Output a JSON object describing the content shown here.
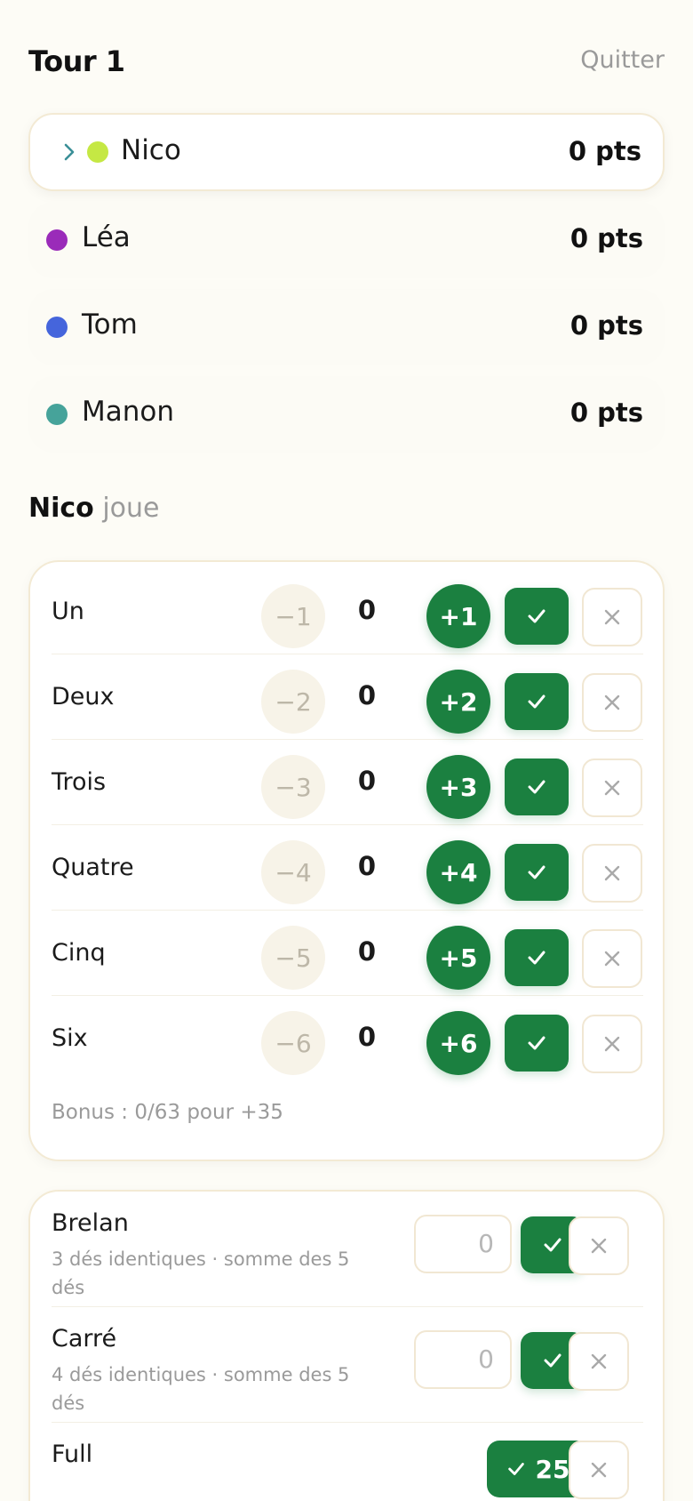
{
  "header": {
    "title": "Tour 1",
    "quit": "Quitter"
  },
  "players": [
    {
      "name": "Nico",
      "points": "0 pts",
      "color": "#c5e844",
      "active": true
    },
    {
      "name": "Léa",
      "points": "0 pts",
      "color": "#9a2bb9",
      "active": false
    },
    {
      "name": "Tom",
      "points": "0 pts",
      "color": "#4565dc",
      "active": false
    },
    {
      "name": "Manon",
      "points": "0 pts",
      "color": "#46a39a",
      "active": false
    }
  ],
  "turn": {
    "player": "Nico",
    "verb": "joue"
  },
  "upper": {
    "rows": [
      {
        "label": "Un",
        "minus": "−1",
        "value": "0",
        "plus": "+1"
      },
      {
        "label": "Deux",
        "minus": "−2",
        "value": "0",
        "plus": "+2"
      },
      {
        "label": "Trois",
        "minus": "−3",
        "value": "0",
        "plus": "+3"
      },
      {
        "label": "Quatre",
        "minus": "−4",
        "value": "0",
        "plus": "+4"
      },
      {
        "label": "Cinq",
        "minus": "−5",
        "value": "0",
        "plus": "+5"
      },
      {
        "label": "Six",
        "minus": "−6",
        "value": "0",
        "plus": "+6"
      }
    ],
    "bonus": "Bonus : 0/63 pour +35"
  },
  "lower": {
    "rows": [
      {
        "label": "Brelan",
        "desc": "3 dés identiques · somme des 5 dés",
        "placeholder": "0"
      },
      {
        "label": "Carré",
        "desc": "4 dés identiques · somme des 5 dés",
        "placeholder": "0"
      },
      {
        "label": "Full",
        "fixed_value": "25"
      }
    ]
  },
  "colors": {
    "accent": "#1b8040",
    "background": "#fdfcf6"
  }
}
